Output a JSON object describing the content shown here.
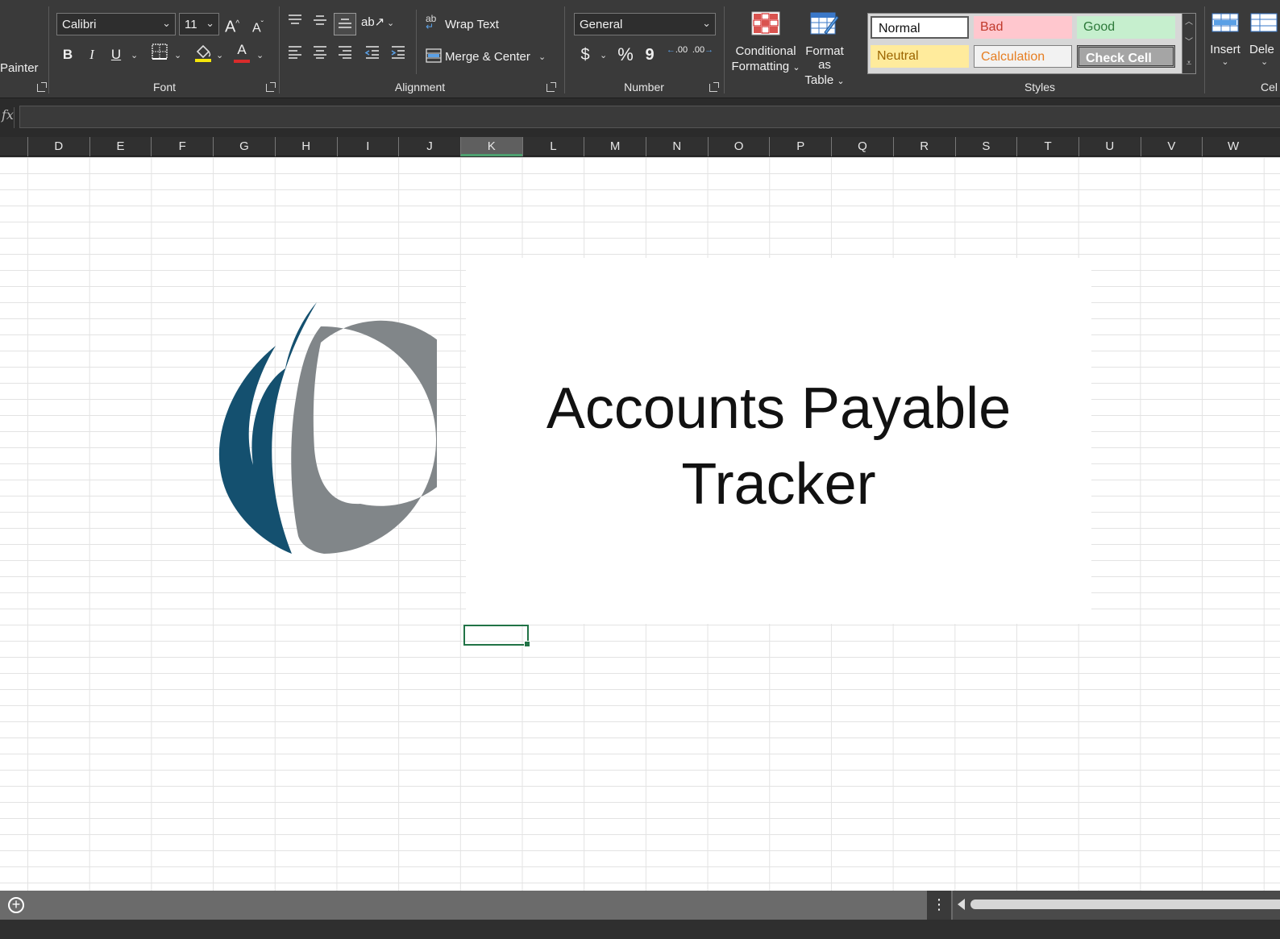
{
  "clipboard": {
    "format_painter_label": "Painter"
  },
  "font": {
    "group_label": "Font",
    "font_name": "Calibri",
    "font_size": "11",
    "bold": "B",
    "italic": "I",
    "underline": "U",
    "grow": "A",
    "shrink": "A",
    "font_color_glyph": "A",
    "fill_color": "#f5e60a",
    "font_color": "#d92b2b"
  },
  "alignment": {
    "group_label": "Alignment",
    "wrap_text": "Wrap Text",
    "merge_center": "Merge & Center"
  },
  "number": {
    "group_label": "Number",
    "format": "General",
    "currency": "$",
    "percent": "%",
    "comma": "9",
    "inc_decimal": ".00",
    "dec_decimal": ".00"
  },
  "styles": {
    "group_label": "Styles",
    "conditional_formatting": [
      "Conditional",
      "Formatting"
    ],
    "format_as_table": [
      "Format as",
      "Table"
    ],
    "cells": [
      {
        "label": "Normal",
        "bg": "#ffffff",
        "fg": "#111111"
      },
      {
        "label": "Bad",
        "bg": "#ffc7ce",
        "fg": "#c0392b"
      },
      {
        "label": "Good",
        "bg": "#c6efce",
        "fg": "#2d7a3a"
      },
      {
        "label": "Neutral",
        "bg": "#ffeb9c",
        "fg": "#9c6500"
      },
      {
        "label": "Calculation",
        "bg": "#f2f2f2",
        "fg": "#e67e22"
      },
      {
        "label": "Check Cell",
        "bg": "#a5a5a5",
        "fg": "#ffffff"
      }
    ]
  },
  "cells_group": {
    "insert": "Insert",
    "delete": "Dele",
    "group_label": "Cel"
  },
  "formula_bar": {
    "fx": "fx",
    "value": ""
  },
  "columns": [
    "D",
    "E",
    "F",
    "G",
    "H",
    "I",
    "J",
    "K",
    "L",
    "M",
    "N",
    "O",
    "P",
    "Q",
    "R",
    "S",
    "T",
    "U",
    "V",
    "W"
  ],
  "selected_column": "K",
  "sheet": {
    "title_line1": "Accounts Payable",
    "title_line2": "Tracker"
  },
  "colors": {
    "logo_blue": "#14506f",
    "logo_gray": "#818689",
    "accent_green": "#217346"
  }
}
